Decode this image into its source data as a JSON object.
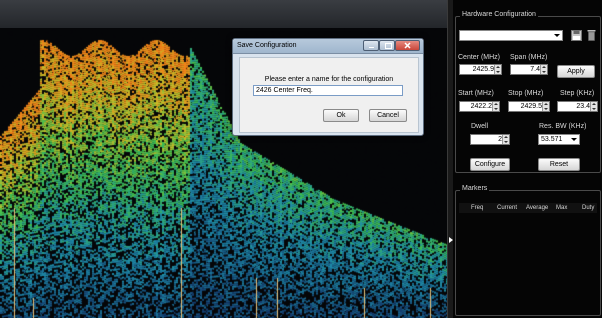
{
  "panel": {
    "hardware_title": "Hardware Configuration",
    "save_icon": "floppy-disk-icon",
    "delete_icon": "trash-icon",
    "center_label": "Center (MHz)",
    "span_label": "Span (MHz)",
    "center_value": "2425.9",
    "span_value": "7.4",
    "apply_label": "Apply",
    "start_label": "Start (MHz)",
    "stop_label": "Stop (MHz)",
    "step_label": "Step (KHz)",
    "start_value": "2422.2",
    "stop_value": "2429.5",
    "step_value": "23.4",
    "dwell_label": "Dwell",
    "dwell_value": "2",
    "resbw_label": "Res. BW (KHz)",
    "resbw_value": "53.571",
    "configure_label": "Configure",
    "reset_label": "Reset",
    "markers_title": "Markers",
    "marker_columns": [
      "Freq",
      "Current",
      "Average",
      "Max",
      "Duty"
    ]
  },
  "dialog": {
    "title": "Save Configuration",
    "message": "Please enter a name for the configuration",
    "input_value": "2426 Center Freq.",
    "ok_label": "Ok",
    "cancel_label": "Cancel"
  },
  "colors": {
    "waterfall_hot": "#f08a1a",
    "waterfall_mid": "#2fbf4a",
    "waterfall_cool": "#1f7fb8",
    "spike": "#e8c27a",
    "close_button": "#c9463a"
  }
}
